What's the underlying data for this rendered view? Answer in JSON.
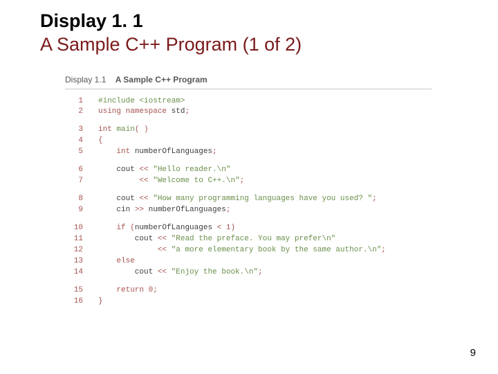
{
  "title": {
    "line1": "Display 1. 1",
    "line2": "A Sample C++ Program (1 of 2)"
  },
  "caption": {
    "label": "Display 1.1",
    "title": "A Sample C++ Program"
  },
  "page_number": "9",
  "code_blocks": [
    [
      {
        "n": "1",
        "tokens": [
          {
            "c": "pp",
            "t": "#include <iostream>"
          }
        ]
      },
      {
        "n": "2",
        "tokens": [
          {
            "c": "kw",
            "t": "using namespace"
          },
          {
            "c": "id",
            "t": " std"
          },
          {
            "c": "op",
            "t": ";"
          }
        ]
      }
    ],
    [
      {
        "n": "3",
        "tokens": [
          {
            "c": "ty",
            "t": "int"
          },
          {
            "c": "id",
            "t": " "
          },
          {
            "c": "fn",
            "t": "main"
          },
          {
            "c": "op",
            "t": "( )"
          }
        ]
      },
      {
        "n": "4",
        "tokens": [
          {
            "c": "op",
            "t": "{"
          }
        ]
      },
      {
        "n": "5",
        "tokens": [
          {
            "c": "id",
            "t": "    "
          },
          {
            "c": "ty",
            "t": "int"
          },
          {
            "c": "id",
            "t": " numberOfLanguages"
          },
          {
            "c": "op",
            "t": ";"
          }
        ]
      }
    ],
    [
      {
        "n": "6",
        "tokens": [
          {
            "c": "id",
            "t": "    cout "
          },
          {
            "c": "op",
            "t": "<<"
          },
          {
            "c": "id",
            "t": " "
          },
          {
            "c": "str",
            "t": "\"Hello reader.\\n\""
          }
        ]
      },
      {
        "n": "7",
        "tokens": [
          {
            "c": "id",
            "t": "         "
          },
          {
            "c": "op",
            "t": "<<"
          },
          {
            "c": "id",
            "t": " "
          },
          {
            "c": "str",
            "t": "\"Welcome to C++.\\n\""
          },
          {
            "c": "op",
            "t": ";"
          }
        ]
      }
    ],
    [
      {
        "n": "8",
        "tokens": [
          {
            "c": "id",
            "t": "    cout "
          },
          {
            "c": "op",
            "t": "<<"
          },
          {
            "c": "id",
            "t": " "
          },
          {
            "c": "str",
            "t": "\"How many programming languages have you used? \""
          },
          {
            "c": "op",
            "t": ";"
          }
        ]
      },
      {
        "n": "9",
        "tokens": [
          {
            "c": "id",
            "t": "    cin "
          },
          {
            "c": "op",
            "t": ">>"
          },
          {
            "c": "id",
            "t": " numberOfLanguages"
          },
          {
            "c": "op",
            "t": ";"
          }
        ]
      }
    ],
    [
      {
        "n": "10",
        "tokens": [
          {
            "c": "id",
            "t": "    "
          },
          {
            "c": "kw",
            "t": "if"
          },
          {
            "c": "id",
            "t": " "
          },
          {
            "c": "op",
            "t": "("
          },
          {
            "c": "id",
            "t": "numberOfLanguages "
          },
          {
            "c": "op",
            "t": "<"
          },
          {
            "c": "id",
            "t": " "
          },
          {
            "c": "num",
            "t": "1"
          },
          {
            "c": "op",
            "t": ")"
          }
        ]
      },
      {
        "n": "11",
        "tokens": [
          {
            "c": "id",
            "t": "        cout "
          },
          {
            "c": "op",
            "t": "<<"
          },
          {
            "c": "id",
            "t": " "
          },
          {
            "c": "str",
            "t": "\"Read the preface. You may prefer\\n\""
          }
        ]
      },
      {
        "n": "12",
        "tokens": [
          {
            "c": "id",
            "t": "             "
          },
          {
            "c": "op",
            "t": "<<"
          },
          {
            "c": "id",
            "t": " "
          },
          {
            "c": "str",
            "t": "\"a more elementary book by the same author.\\n\""
          },
          {
            "c": "op",
            "t": ";"
          }
        ]
      },
      {
        "n": "13",
        "tokens": [
          {
            "c": "id",
            "t": "    "
          },
          {
            "c": "kw",
            "t": "else"
          }
        ]
      },
      {
        "n": "14",
        "tokens": [
          {
            "c": "id",
            "t": "        cout "
          },
          {
            "c": "op",
            "t": "<<"
          },
          {
            "c": "id",
            "t": " "
          },
          {
            "c": "str",
            "t": "\"Enjoy the book.\\n\""
          },
          {
            "c": "op",
            "t": ";"
          }
        ]
      }
    ],
    [
      {
        "n": "15",
        "tokens": [
          {
            "c": "id",
            "t": "    "
          },
          {
            "c": "kw",
            "t": "return"
          },
          {
            "c": "id",
            "t": " "
          },
          {
            "c": "num",
            "t": "0"
          },
          {
            "c": "op",
            "t": ";"
          }
        ]
      },
      {
        "n": "16",
        "tokens": [
          {
            "c": "op",
            "t": "}"
          }
        ]
      }
    ]
  ]
}
